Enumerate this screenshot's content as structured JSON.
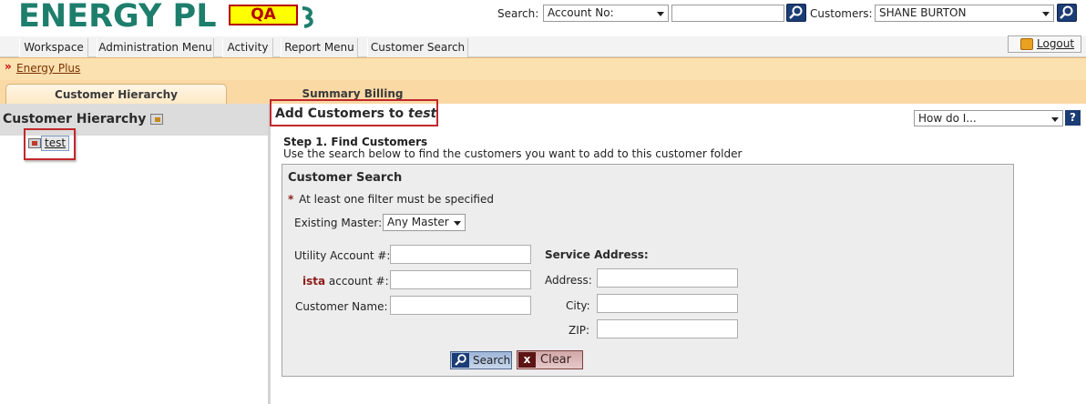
{
  "header": {
    "logo_text": "ENERGY PL",
    "env_badge": "QA",
    "search_label": "Search:",
    "search_type": "Account No:",
    "search_value": "",
    "customers_label": "Customers:",
    "customer_selected": "SHANE BURTON"
  },
  "menu": {
    "items": [
      "Workspace",
      "Administration Menu",
      "Activity",
      "Report Menu",
      "Customer Search"
    ],
    "logout_label": "Logout"
  },
  "breadcrumb": {
    "link": "Energy Plus"
  },
  "tabs": [
    {
      "label": "Customer Hierarchy",
      "active": true
    },
    {
      "label": "Summary Billing",
      "active": false
    }
  ],
  "left": {
    "title": "Customer Hierarchy",
    "node_label": "test"
  },
  "main": {
    "title_prefix": "Add Customers to",
    "title_folder": "test",
    "howdo_placeholder": "How do I...",
    "help_glyph": "?",
    "step_title": "Step 1. Find Customers",
    "step_desc": "Use the search below to find the customers you want to add to this customer folder",
    "panel": {
      "title": "Customer Search",
      "required_star": "*",
      "required_note": "At least one filter must be specified",
      "existing_master_label": "Existing Master:",
      "existing_master_value": "Any Master",
      "utility_account_label": "Utility Account #:",
      "ista_brand": "ista",
      "ista_account_label": "account #:",
      "customer_name_label": "Customer Name:",
      "service_address_title": "Service Address:",
      "address_label": "Address:",
      "city_label": "City:",
      "zip_label": "ZIP:",
      "search_button": "Search",
      "clear_button": "Clear",
      "clear_glyph": "x"
    }
  },
  "colors": {
    "brand_green": "#1e7e6c",
    "highlight_red": "#c0282c",
    "nav_blue": "#1b3c74",
    "tab_orange": "#fbd9a5"
  }
}
